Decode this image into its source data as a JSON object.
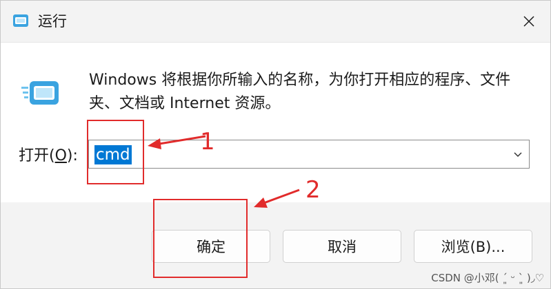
{
  "window": {
    "title": "运行",
    "close_icon": "close-icon",
    "app_icon": "run-dialog-icon"
  },
  "content": {
    "description": "Windows 将根据你所输入的名称，为你打开相应的程序、文件夹、文档或 Internet 资源。",
    "open_label_prefix": "打开(",
    "open_label_mnemonic": "O",
    "open_label_suffix": "):",
    "command_value": "cmd",
    "dropdown_icon": "chevron-down-icon"
  },
  "buttons": {
    "ok_label": "确定",
    "cancel_label": "取消",
    "browse_label": "浏览(B)..."
  },
  "annotations": {
    "step1": "1",
    "step2": "2",
    "color": "#e12b2b"
  },
  "watermark": "CSDN @小邓( ´͈ ᵕ `͈ )◞♡",
  "colors": {
    "accent": "#0078d4",
    "window_bg": "#f3f3f3",
    "content_bg": "#ffffff"
  }
}
